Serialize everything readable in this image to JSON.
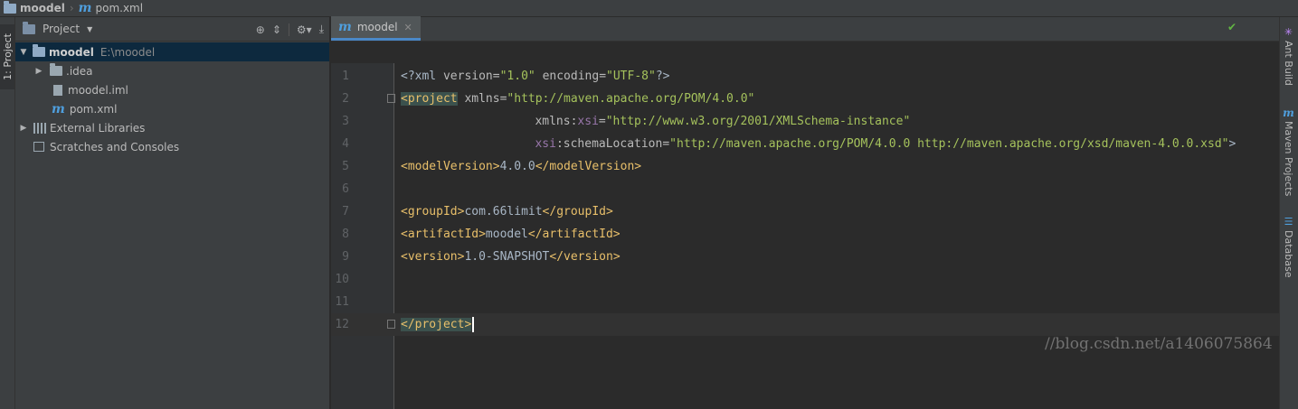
{
  "breadcrumb": {
    "project": "moodel",
    "file": "pom.xml"
  },
  "left_tool": {
    "project_tab": "1: Project"
  },
  "project_panel": {
    "title": "Project",
    "tree": [
      {
        "label": "moodel",
        "path": "E:\\moodel"
      },
      {
        "label": ".idea"
      },
      {
        "label": "moodel.iml"
      },
      {
        "label": "pom.xml"
      },
      {
        "label": "External Libraries"
      },
      {
        "label": "Scratches and Consoles"
      }
    ]
  },
  "editor": {
    "tab": "moodel",
    "lines": [
      {
        "n": "1",
        "parts": [
          "<?xml ",
          "version",
          "=",
          "\"1.0\"",
          " ",
          "encoding",
          "=",
          "\"UTF-8\"",
          "?>"
        ]
      },
      {
        "n": "2",
        "parts": [
          "<project",
          " ",
          "xmlns",
          "=",
          "\"http://maven.apache.org/POM/4.0.0\""
        ]
      },
      {
        "n": "3",
        "parts": [
          "         ",
          "xmlns:",
          "xsi",
          "=",
          "\"http://www.w3.org/2001/XMLSchema-instance\""
        ]
      },
      {
        "n": "4",
        "parts": [
          "         ",
          "xsi",
          ":schemaLocation",
          "=",
          "\"http://maven.apache.org/POM/4.0.0 http://maven.apache.org/xsd/maven-4.0.0.xsd\"",
          ">"
        ]
      },
      {
        "n": "5",
        "parts": [
          "<modelVersion>",
          "4.0.0",
          "</modelVersion>"
        ]
      },
      {
        "n": "6",
        "parts": []
      },
      {
        "n": "7",
        "parts": [
          "<groupId>",
          "com.66limit",
          "</groupId>"
        ]
      },
      {
        "n": "8",
        "parts": [
          "<artifactId>",
          "moodel",
          "</artifactId>"
        ]
      },
      {
        "n": "9",
        "parts": [
          "<version>",
          "1.0-SNAPSHOT",
          "</version>"
        ]
      },
      {
        "n": "10",
        "parts": []
      },
      {
        "n": "11",
        "parts": []
      },
      {
        "n": "12",
        "parts": [
          "</project>"
        ]
      }
    ]
  },
  "right_tools": {
    "ant": "Ant Build",
    "maven": "Maven Projects",
    "database": "Database"
  },
  "watermark": "//blog.csdn.net/a1406075864",
  "colors": {
    "accent": "#4a88c7",
    "selection": "#0d293e",
    "tag": "#e8bf6a",
    "string": "#a5c25c"
  }
}
